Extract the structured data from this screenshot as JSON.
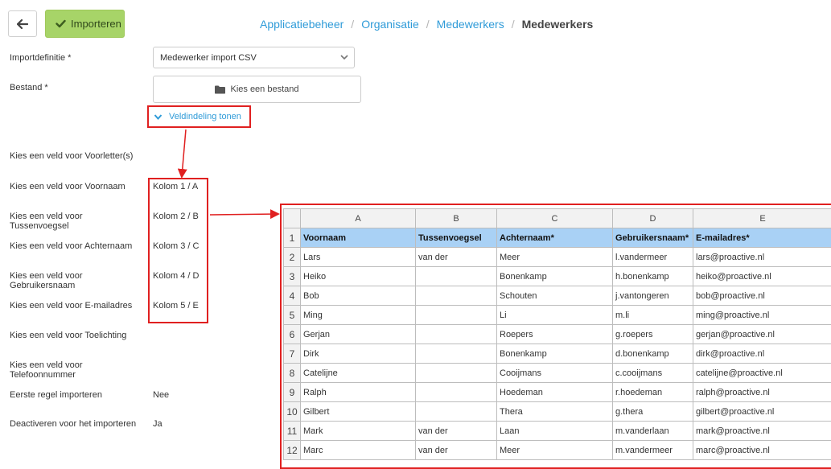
{
  "toolbar": {
    "back_icon": "arrow-left-icon",
    "import_icon": "check-icon",
    "import_label": "Importeren"
  },
  "breadcrumb": {
    "items": [
      "Applicatiebeheer",
      "Organisatie",
      "Medewerkers"
    ],
    "current": "Medewerkers",
    "separator": "/"
  },
  "form": {
    "importdefinitie_label": "Importdefinitie *",
    "importdefinitie_value": "Medewerker import CSV",
    "bestand_label": "Bestand *",
    "file_button_label": "Kies een bestand",
    "toggle_label": "Veldindeling tonen",
    "fields": [
      {
        "label": "Kies een veld voor Voorletter(s)",
        "value": ""
      },
      {
        "label": "Kies een veld voor Voornaam",
        "value": "Kolom 1 / A"
      },
      {
        "label": "Kies een veld voor Tussenvoegsel",
        "value": "Kolom 2 / B"
      },
      {
        "label": "Kies een veld voor Achternaam",
        "value": "Kolom 3 / C"
      },
      {
        "label": "Kies een veld voor Gebruikersnaam",
        "value": "Kolom 4 / D"
      },
      {
        "label": "Kies een veld voor E-mailadres",
        "value": "Kolom 5 / E"
      },
      {
        "label": "Kies een veld voor Toelichting",
        "value": ""
      },
      {
        "label": "Kies een veld voor Telefoonnummer",
        "value": ""
      },
      {
        "label": "Eerste regel importeren",
        "value": "Nee"
      },
      {
        "label": "Deactiveren voor het importeren",
        "value": "Ja"
      }
    ]
  },
  "spreadsheet": {
    "columns": [
      "A",
      "B",
      "C",
      "D",
      "E"
    ],
    "rows": [
      [
        "Voornaam",
        "Tussenvoegsel",
        "Achternaam*",
        "Gebruikersnaam*",
        "E-mailadres*"
      ],
      [
        "Lars",
        "van der",
        "Meer",
        "l.vandermeer",
        "lars@proactive.nl"
      ],
      [
        "Heiko",
        "",
        "Bonenkamp",
        "h.bonenkamp",
        "heiko@proactive.nl"
      ],
      [
        "Bob",
        "",
        "Schouten",
        "j.vantongeren",
        "bob@proactive.nl"
      ],
      [
        "Ming",
        "",
        "Li",
        "m.li",
        "ming@proactive.nl"
      ],
      [
        "Gerjan",
        "",
        "Roepers",
        "g.roepers",
        "gerjan@proactive.nl"
      ],
      [
        "Dirk",
        "",
        "Bonenkamp",
        "d.bonenkamp",
        "dirk@proactive.nl"
      ],
      [
        "Catelijne",
        "",
        "Cooijmans",
        "c.cooijmans",
        "catelijne@proactive.nl"
      ],
      [
        "Ralph",
        "",
        "Hoedeman",
        "r.hoedeman",
        "ralph@proactive.nl"
      ],
      [
        "Gilbert",
        "",
        "Thera",
        "g.thera",
        "gilbert@proactive.nl"
      ],
      [
        "Mark",
        "van der",
        "Laan",
        "m.vanderlaan",
        "mark@proactive.nl"
      ],
      [
        "Marc",
        "van der",
        "Meer",
        "m.vandermeer",
        "marc@proactive.nl"
      ]
    ]
  },
  "colors": {
    "accent": "#2f9bd8",
    "import_button": "#a7d468",
    "highlight": "#e02020",
    "header_row": "#a9d1f5"
  }
}
